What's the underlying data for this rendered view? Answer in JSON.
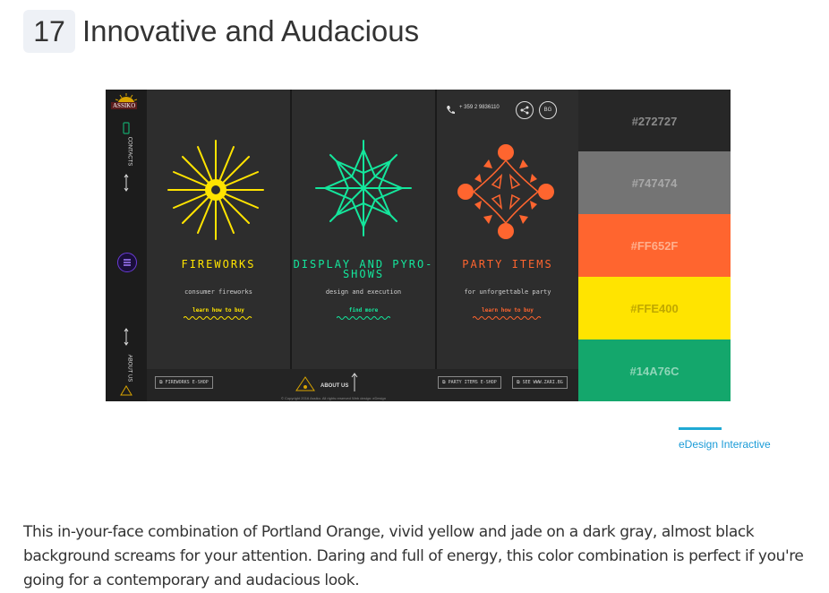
{
  "heading": {
    "number": "17",
    "title": "Innovative and Audacious"
  },
  "site": {
    "logo_text": "ASSIKO",
    "sidebar": {
      "contacts": "CONTACTS",
      "about": "ABOUT US"
    },
    "phone": "+ 359 2 9836110",
    "lang": "BG",
    "columns": [
      {
        "title": "FIREWORKS",
        "subtitle": "consumer fireworks",
        "link": "learn how to buy",
        "color": "#FFE400"
      },
      {
        "title": "DISPLAY AND PYRO-SHOWS",
        "subtitle": "design and execution",
        "link": "find more",
        "color": "#14A76C"
      },
      {
        "title": "PARTY ITEMS",
        "subtitle": "for unforgettable party",
        "link": "learn how to buy",
        "color": "#FF652F"
      }
    ],
    "footer": {
      "fireworks_shop": "FIREWORKS E-SHOP",
      "about": "ABOUT US",
      "party_shop": "PARTY ITEMS E-SHOP",
      "zari": "SEE WWW.ZARI.BG",
      "copyright": "© Copyright 2016 Assiko. All rights reserved    Web design: eDesign"
    }
  },
  "palette": [
    {
      "hex": "#272727",
      "text_color": "#8a8a8a"
    },
    {
      "hex": "#747474",
      "text_color": "#a8a8a8"
    },
    {
      "hex": "#FF652F",
      "text_color": "#ffb08e"
    },
    {
      "hex": "#FFE400",
      "text_color": "#c0a800"
    },
    {
      "hex": "#14A76C",
      "text_color": "#8fd6b8"
    }
  ],
  "credit": "eDesign Interactive",
  "description": "This in-your-face combination of Portland Orange, vivid yellow and jade on a dark gray, almost black background screams for your attention. Daring and full of energy, this color combination is perfect if you're going for a contemporary and audacious look."
}
